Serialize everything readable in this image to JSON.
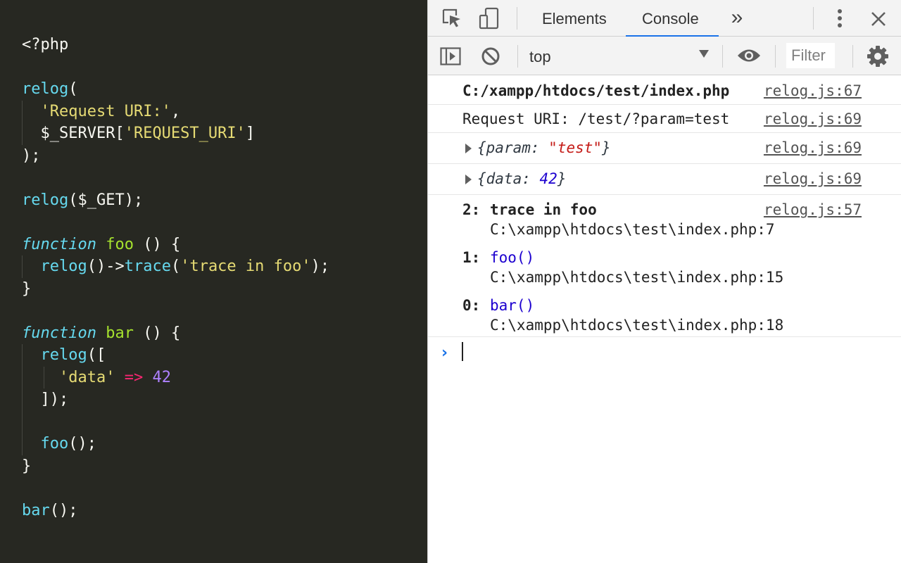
{
  "editor": {
    "lines": [
      [
        {
          "t": "<?php",
          "c": "plain"
        }
      ],
      [],
      [
        {
          "t": "relog",
          "c": "fn"
        },
        {
          "t": "(",
          "c": "plain"
        }
      ],
      [
        {
          "t": "  ",
          "c": "plain"
        },
        {
          "t": "'Request URI:'",
          "c": "str"
        },
        {
          "t": ",",
          "c": "plain"
        }
      ],
      [
        {
          "t": "  $_SERVER[",
          "c": "plain"
        },
        {
          "t": "'REQUEST_URI'",
          "c": "str"
        },
        {
          "t": "]",
          "c": "plain"
        }
      ],
      [
        {
          "t": ");",
          "c": "plain"
        }
      ],
      [],
      [
        {
          "t": "relog",
          "c": "fn"
        },
        {
          "t": "($_GET);",
          "c": "plain"
        }
      ],
      [],
      [
        {
          "t": "function",
          "c": "kw"
        },
        {
          "t": " ",
          "c": "plain"
        },
        {
          "t": "foo",
          "c": "name"
        },
        {
          "t": " () {",
          "c": "plain"
        }
      ],
      [
        {
          "t": "  ",
          "c": "plain"
        },
        {
          "t": "relog",
          "c": "fn"
        },
        {
          "t": "()->",
          "c": "plain"
        },
        {
          "t": "trace",
          "c": "fn"
        },
        {
          "t": "(",
          "c": "plain"
        },
        {
          "t": "'trace in foo'",
          "c": "str"
        },
        {
          "t": ");",
          "c": "plain"
        }
      ],
      [
        {
          "t": "}",
          "c": "plain"
        }
      ],
      [],
      [
        {
          "t": "function",
          "c": "kw"
        },
        {
          "t": " ",
          "c": "plain"
        },
        {
          "t": "bar",
          "c": "name"
        },
        {
          "t": " () {",
          "c": "plain"
        }
      ],
      [
        {
          "t": "  ",
          "c": "plain"
        },
        {
          "t": "relog",
          "c": "fn"
        },
        {
          "t": "([",
          "c": "plain"
        }
      ],
      [
        {
          "t": "    ",
          "c": "plain"
        },
        {
          "t": "'data'",
          "c": "str"
        },
        {
          "t": " ",
          "c": "plain"
        },
        {
          "t": "=>",
          "c": "op"
        },
        {
          "t": " ",
          "c": "plain"
        },
        {
          "t": "42",
          "c": "num"
        }
      ],
      [
        {
          "t": "  ]);",
          "c": "plain"
        }
      ],
      [],
      [
        {
          "t": "  ",
          "c": "plain"
        },
        {
          "t": "foo",
          "c": "fn"
        },
        {
          "t": "();",
          "c": "plain"
        }
      ],
      [
        {
          "t": "}",
          "c": "plain"
        }
      ],
      [],
      [
        {
          "t": "bar",
          "c": "fn"
        },
        {
          "t": "();",
          "c": "plain"
        }
      ]
    ]
  },
  "devtools": {
    "tabs": [
      {
        "label": "Elements",
        "active": false
      },
      {
        "label": "Console",
        "active": true
      }
    ],
    "more_tabs_glyph": "»",
    "context": "top",
    "filter_placeholder": "Filter"
  },
  "console": {
    "messages": [
      {
        "text": "C:/xampp/htdocs/test/index.php",
        "source": "relog.js:67"
      },
      {
        "text": "Request URI: /test/?param=test",
        "source": "relog.js:69"
      },
      {
        "obj_open": "{",
        "obj_key": "param",
        "obj_sep": ": ",
        "obj_value": "\"test\"",
        "obj_close": "}",
        "source": "relog.js:69"
      },
      {
        "obj_open": "{",
        "obj_key": "data",
        "obj_sep": ": ",
        "obj_value": "42",
        "obj_close": "}",
        "source": "relog.js:69"
      }
    ],
    "trace": {
      "source": "relog.js:57",
      "frames": [
        {
          "index": "2:",
          "name": "trace in foo",
          "location": "C:\\xampp\\htdocs\\test\\index.php:7"
        },
        {
          "index": "1:",
          "name": "foo()",
          "location": "C:\\xampp\\htdocs\\test\\index.php:15"
        },
        {
          "index": "0:",
          "name": "bar()",
          "location": "C:\\xampp\\htdocs\\test\\index.php:18"
        }
      ]
    },
    "prompt_glyph": "›"
  },
  "colors": {
    "editor_bg": "#272822",
    "accent": "#1a73e8",
    "string_red": "#c41a16",
    "number_blue": "#1c00cf"
  }
}
